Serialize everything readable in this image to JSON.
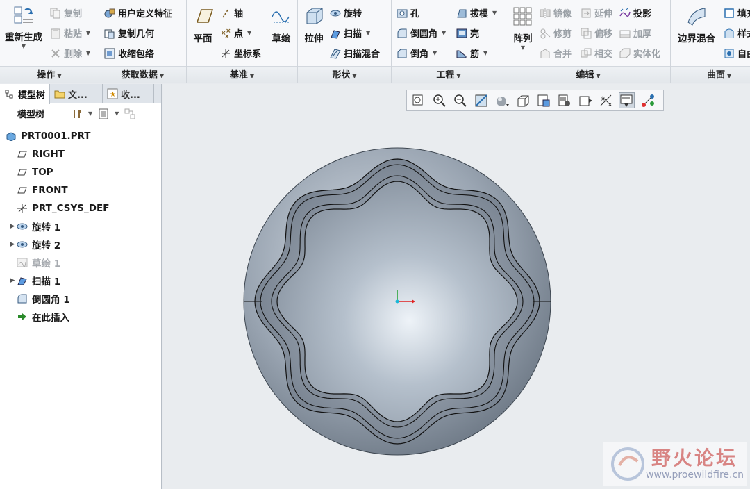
{
  "ribbon": {
    "groups": {
      "operations": {
        "label": "操作",
        "regenerate": "重新生成",
        "copy": "复制",
        "paste": "粘贴",
        "delete": "删除"
      },
      "get_data": {
        "label": "获取数据",
        "udf": "用户定义特征",
        "copy_geometry": "复制几何",
        "shrinkwrap": "收缩包络"
      },
      "datum": {
        "label": "基准",
        "plane": "平面",
        "axis": "轴",
        "point": "点",
        "csys": "坐标系",
        "sketch": "草绘"
      },
      "shapes": {
        "label": "形状",
        "extrude": "拉伸",
        "revolve": "旋转",
        "sweep": "扫描",
        "swept_blend": "扫描混合"
      },
      "engineering": {
        "label": "工程",
        "hole": "孔",
        "draft": "拔模",
        "round": "倒圆角",
        "shell": "壳",
        "chamfer": "倒角",
        "rib": "筋"
      },
      "editing": {
        "label": "编辑",
        "pattern": "阵列",
        "mirror": "镜像",
        "extend": "延伸",
        "project": "投影",
        "trim": "修剪",
        "offset": "偏移",
        "thicken": "加厚",
        "merge": "合并",
        "intersect": "相交",
        "solidify": "实体化"
      },
      "surfaces": {
        "label": "曲面",
        "boundary_blend": "边界混合",
        "fill": "填充",
        "style": "样式",
        "freestyle": "自由式"
      }
    }
  },
  "left_panel": {
    "tabs": [
      "模型树",
      "文...",
      "收..."
    ],
    "toolbar_label": "模型树",
    "tree": [
      {
        "label": "PRT0001.PRT",
        "icon": "part-icon",
        "expandable": false,
        "dim": false
      },
      {
        "label": "RIGHT",
        "icon": "datum-plane-icon",
        "expandable": false,
        "dim": false
      },
      {
        "label": "TOP",
        "icon": "datum-plane-icon",
        "expandable": false,
        "dim": false
      },
      {
        "label": "FRONT",
        "icon": "datum-plane-icon",
        "expandable": false,
        "dim": false
      },
      {
        "label": "PRT_CSYS_DEF",
        "icon": "csys-icon",
        "expandable": false,
        "dim": false
      },
      {
        "label": "旋转 1",
        "icon": "revolve-icon",
        "expandable": true,
        "dim": false
      },
      {
        "label": "旋转 2",
        "icon": "revolve-icon",
        "expandable": true,
        "dim": false
      },
      {
        "label": "草绘 1",
        "icon": "sketch-icon",
        "expandable": false,
        "dim": true
      },
      {
        "label": "扫描 1",
        "icon": "sweep-icon",
        "expandable": true,
        "dim": false
      },
      {
        "label": "倒圆角 1",
        "icon": "round-icon",
        "expandable": false,
        "dim": false
      },
      {
        "label": "在此插入",
        "icon": "insert-here-icon",
        "expandable": false,
        "dim": false
      }
    ]
  },
  "viewport": {
    "toolbar_icons": [
      "refit-icon",
      "zoom-in-icon",
      "zoom-out-icon",
      "repaint-icon",
      "display-style-icon",
      "saved-views-icon",
      "view-manager-icon",
      "perspective-icon",
      "spin-center-icon",
      "datum-display-icon",
      "annotation-display-icon",
      "csys-display-icon"
    ]
  },
  "watermark": {
    "title": "野火论坛",
    "url": "www.proewildfire.cn"
  },
  "colors": {
    "accent": "#2f7fc0",
    "part_base": "#8e98a5",
    "part_light": "#dfe6ee",
    "watermark_red": "#c63a37"
  }
}
